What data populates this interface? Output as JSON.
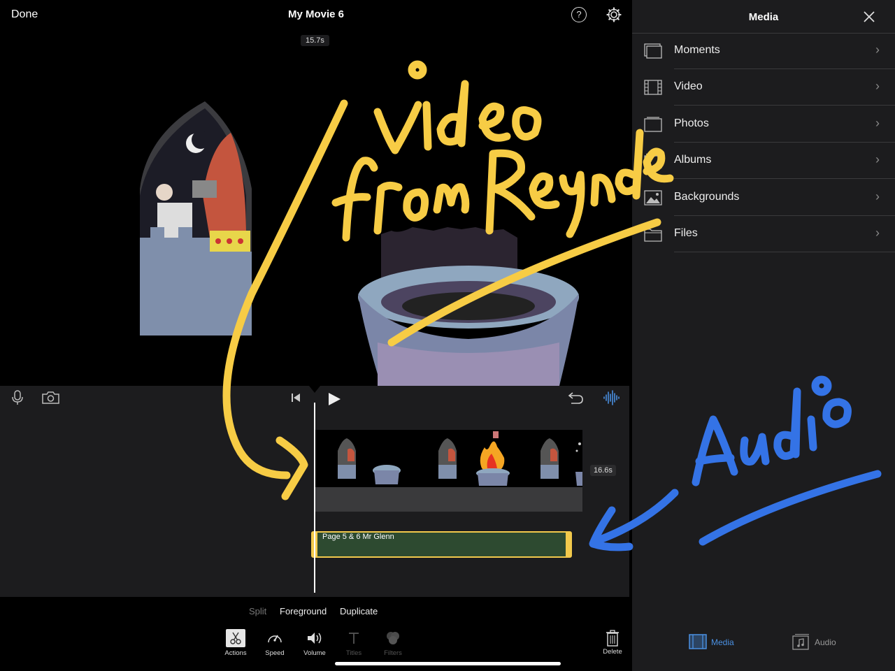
{
  "header": {
    "done_label": "Done",
    "title": "My Movie 6",
    "help_glyph": "?",
    "preview_duration": "15.7s"
  },
  "timeline": {
    "clip_duration": "16.6s",
    "audio_clip_label": "Page 5 & 6 Mr Glenn"
  },
  "clip_options": [
    "Split",
    "Foreground",
    "Duplicate"
  ],
  "tools": [
    {
      "label": "Actions",
      "icon": "scissors-icon",
      "active": true
    },
    {
      "label": "Speed",
      "icon": "speedometer-icon",
      "active": false
    },
    {
      "label": "Volume",
      "icon": "speaker-icon",
      "active": false
    },
    {
      "label": "Titles",
      "icon": "text-icon",
      "active": false
    },
    {
      "label": "Filters",
      "icon": "filters-icon",
      "active": false
    }
  ],
  "delete_label": "Delete",
  "panel": {
    "title": "Media",
    "rows": [
      {
        "label": "Moments",
        "icon": "moments-icon"
      },
      {
        "label": "Video",
        "icon": "film-icon"
      },
      {
        "label": "Photos",
        "icon": "photos-icon"
      },
      {
        "label": "Albums",
        "icon": "albums-icon"
      },
      {
        "label": "Backgrounds",
        "icon": "landscape-icon"
      },
      {
        "label": "Files",
        "icon": "folder-icon"
      }
    ],
    "tabs": [
      {
        "label": "Media",
        "active": true
      },
      {
        "label": "Audio",
        "active": false
      }
    ]
  },
  "colors": {
    "accent_blue": "#4a90e2",
    "audio_clip": "#2d4a30",
    "clip_border": "#f2c94c",
    "annotation_yellow": "#f7cc45",
    "annotation_blue": "#3473e6",
    "disabled": "#6e6e73"
  }
}
